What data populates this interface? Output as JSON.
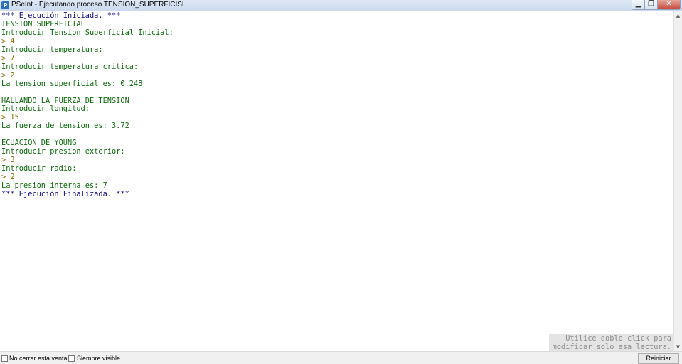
{
  "window": {
    "title": "PSeInt - Ejecutando proceso TENSION_SUPERFICISL",
    "minimize_glyph": "▁",
    "maximize_glyph": "❐",
    "close_glyph": "✕"
  },
  "console": {
    "lines": [
      {
        "text": "*** Ejecución Iniciada. ***",
        "kind": "system"
      },
      {
        "text": "TENSION SUPERFICIAL",
        "kind": "output"
      },
      {
        "text": "Introducir Tension Superficial Inicial:",
        "kind": "output"
      },
      {
        "text": "> 4",
        "kind": "input"
      },
      {
        "text": "Introducir temperatura:",
        "kind": "output"
      },
      {
        "text": "> 7",
        "kind": "input"
      },
      {
        "text": "Introducir temperatura critica:",
        "kind": "output"
      },
      {
        "text": "> 2",
        "kind": "input"
      },
      {
        "text": "La tension superficial es: 0.248",
        "kind": "output"
      },
      {
        "text": "",
        "kind": "output"
      },
      {
        "text": "HALLANDO LA FUERZA DE TENSION",
        "kind": "output"
      },
      {
        "text": "Introducir longitud:",
        "kind": "output"
      },
      {
        "text": "> 15",
        "kind": "input"
      },
      {
        "text": "La fuerza de tension es: 3.72",
        "kind": "output"
      },
      {
        "text": "",
        "kind": "output"
      },
      {
        "text": "ECUACION DE YOUNG",
        "kind": "output"
      },
      {
        "text": "Introducir presion exterior:",
        "kind": "output"
      },
      {
        "text": "> 3",
        "kind": "input"
      },
      {
        "text": "Introducir radio:",
        "kind": "output"
      },
      {
        "text": "> 2",
        "kind": "input"
      },
      {
        "text": "La presion interna es: 7",
        "kind": "output"
      },
      {
        "text": "*** Ejecución Finalizada. ***",
        "kind": "system"
      }
    ],
    "colors": {
      "system": "#12128c",
      "output": "#0f6a0f",
      "input": "#8a6b00"
    }
  },
  "hint": {
    "line1": "Utilice doble click para",
    "line2": "modificar solo esa lectura."
  },
  "bottombar": {
    "no_close_label": "No cerrar esta ventana",
    "always_visible_label": "Siempre visible",
    "restart_label": "Reiniciar"
  }
}
